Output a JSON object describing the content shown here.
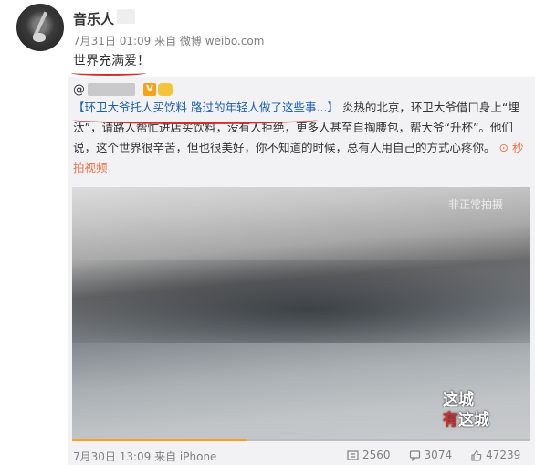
{
  "post": {
    "author": "音乐人",
    "meta": "7月31日 01:09 来自 微博 weibo.com",
    "text": "世界充满爱！"
  },
  "repost": {
    "user_prefix": "@",
    "body_topic": "【环卫大爷托人买饮料 路过的年轻人做了这些事...】",
    "body_text": "炎热的北京，环卫大爷借口身上“埋汰”，请路人帮忙进店买饮料，没有人拒绝，更多人甚至自掏腰包，帮大爷“升杯”。他们说，这个世界很辛苦，但也很美好，你不知道的时候，总有人用自己的方式心疼你。",
    "video_link": "秒拍视频",
    "video_watermark": "非正常拍摄",
    "logo_line1": "这城",
    "logo_line2_a": "有",
    "logo_line2_b": "这城",
    "footer_time": "7月30日 13:09 来自 iPhone",
    "repost_count": "2560",
    "comment_count": "3074",
    "like_count": "47239",
    "video_progress": 0.38
  },
  "colors": {
    "link": "#1a5fb0",
    "accent": "#eb7350",
    "highlight_red": "#d62b2b",
    "progress": "#f7a21b"
  }
}
